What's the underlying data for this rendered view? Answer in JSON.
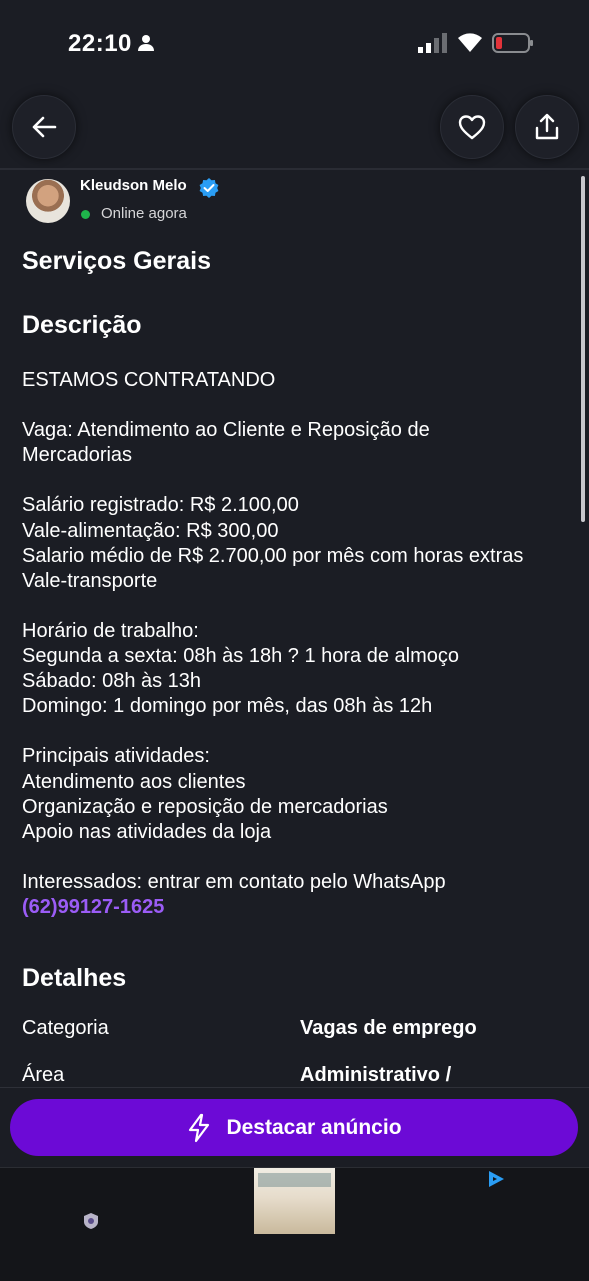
{
  "status_bar": {
    "time": "22:10"
  },
  "seller": {
    "name": "Kleudson Melo",
    "status": "Online agora"
  },
  "listing": {
    "title": "Serviços Gerais",
    "description_heading": "Descrição",
    "description_lines": [
      "ESTAMOS CONTRATANDO",
      "",
      "Vaga: Atendimento ao Cliente e Reposição de",
      "Mercadorias",
      "",
      "Salário registrado: R$ 2.100,00",
      "Vale-alimentação: R$ 300,00",
      "Salario médio de R$ 2.700,00 por mês com horas extras",
      "Vale-transporte",
      "",
      "Horário de trabalho:",
      "Segunda a sexta: 08h às 18h ? 1 hora de almoço",
      "Sábado: 08h às 13h",
      "Domingo: 1 domingo por mês, das 08h às 12h",
      "",
      "Principais atividades:",
      "Atendimento aos clientes",
      "Organização e reposição de mercadorias",
      "Apoio nas atividades da loja",
      "",
      "Interessados: entrar em contato pelo WhatsApp"
    ],
    "phone": "(62)99127-1625",
    "details_heading": "Detalhes",
    "details": [
      {
        "label": "Categoria",
        "value": "Vagas de emprego"
      },
      {
        "label": "Área",
        "value": "Administrativo /"
      }
    ]
  },
  "cta": {
    "label": "Destacar anúncio"
  },
  "colors": {
    "background": "#1b1d24",
    "accent": "#6c0ad6",
    "link": "#9b5cf6",
    "online": "#1fb54b",
    "verified": "#2a9df4"
  },
  "icons": [
    "person-icon",
    "signal-icon",
    "wifi-icon",
    "battery-icon",
    "back-arrow-icon",
    "heart-icon",
    "share-icon",
    "verified-badge-icon",
    "lightning-icon",
    "ad-choices-icon"
  ]
}
